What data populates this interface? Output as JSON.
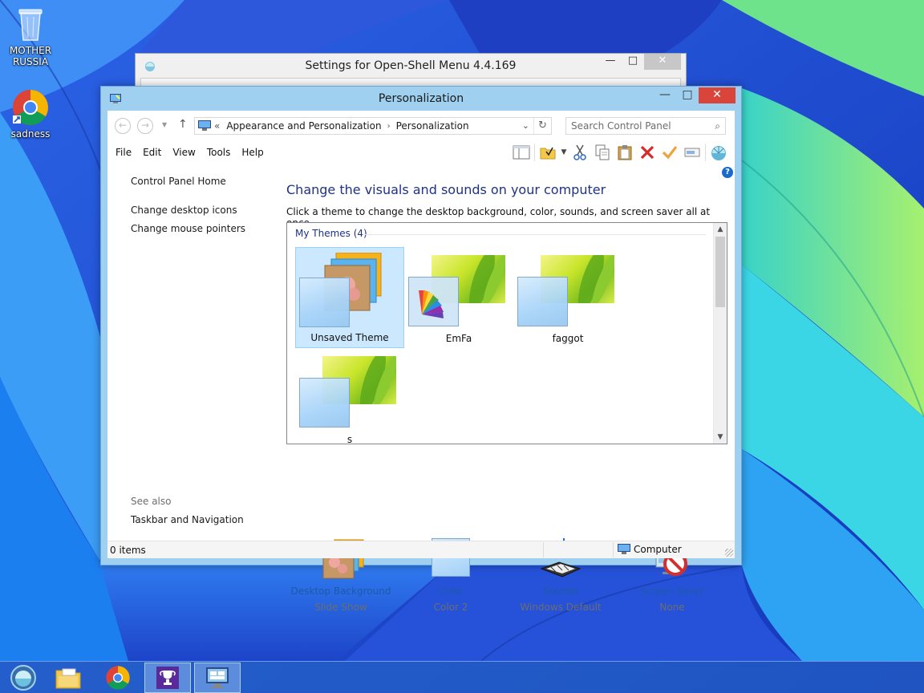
{
  "desktop": {
    "icons": [
      {
        "label": "MOTHER RUSSIA",
        "icon": "recycle-bin-icon"
      },
      {
        "label": "sadness",
        "icon": "chrome-icon"
      }
    ]
  },
  "back_window": {
    "title": "Settings for Open-Shell Menu 4.4.169"
  },
  "window": {
    "title": "Personalization",
    "caption": {
      "minimize": "—",
      "maximize": "□",
      "close": "✕"
    },
    "address": {
      "prefix": "«",
      "crumbs": [
        "Appearance and Personalization",
        "Personalization"
      ],
      "separator": "›",
      "dropdown": "⌄",
      "refresh": "↻"
    },
    "search": {
      "placeholder": "Search Control Panel",
      "icon": "⌕"
    },
    "nav": {
      "back": "←",
      "forward": "→",
      "history": "▼",
      "up": "↑"
    },
    "menu": [
      "File",
      "Edit",
      "View",
      "Tools",
      "Help"
    ],
    "left_pane": {
      "links": [
        "Control Panel Home",
        "Change desktop icons",
        "Change mouse pointers"
      ],
      "see_also_label": "See also",
      "see_also_links": [
        "Taskbar and Navigation"
      ]
    },
    "heading": "Change the visuals and sounds on your computer",
    "subtext": "Click a theme to change the desktop background, color, sounds, and screen saver all at once.",
    "themes": {
      "group_label": "My Themes (4)",
      "items": [
        {
          "name": "Unsaved Theme",
          "selected": true
        },
        {
          "name": "EmFa",
          "selected": false
        },
        {
          "name": "faggot",
          "selected": false
        },
        {
          "name": "s",
          "selected": false
        }
      ]
    },
    "options": [
      {
        "label": "Desktop Background",
        "value": "Slide Show",
        "icon": "desktop-background-icon"
      },
      {
        "label": "Color",
        "value": "Color 2",
        "icon": "color-icon"
      },
      {
        "label": "Sounds",
        "value": "Windows Default",
        "icon": "sounds-icon"
      },
      {
        "label": "Screen Saver",
        "value": "None",
        "icon": "screen-saver-icon"
      }
    ],
    "status": {
      "items": "0 items",
      "location": "Computer"
    }
  },
  "help_glyph": "?",
  "taskbar": {
    "buttons": [
      {
        "icon": "start-orb-icon"
      },
      {
        "icon": "file-explorer-icon"
      },
      {
        "icon": "chrome-icon"
      },
      {
        "icon": "trophy-icon"
      },
      {
        "icon": "control-panel-icon"
      }
    ]
  },
  "colors": {
    "accent_link": "#1e5aa8",
    "heading": "#1e3287",
    "close_red": "#d9453a",
    "selection": "#cce8ff"
  }
}
